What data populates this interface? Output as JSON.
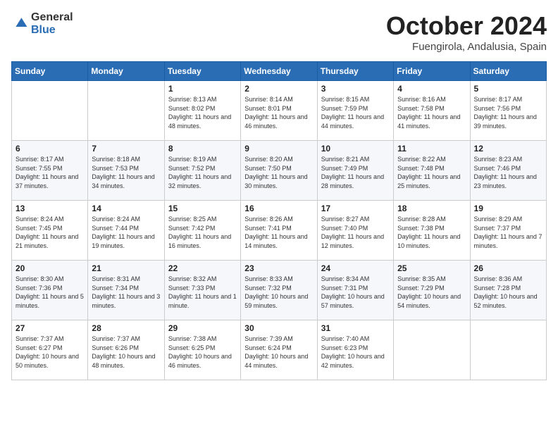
{
  "header": {
    "logo_general": "General",
    "logo_blue": "Blue",
    "month": "October 2024",
    "location": "Fuengirola, Andalusia, Spain"
  },
  "weekdays": [
    "Sunday",
    "Monday",
    "Tuesday",
    "Wednesday",
    "Thursday",
    "Friday",
    "Saturday"
  ],
  "weeks": [
    [
      {
        "day": "",
        "info": ""
      },
      {
        "day": "",
        "info": ""
      },
      {
        "day": "1",
        "info": "Sunrise: 8:13 AM\nSunset: 8:02 PM\nDaylight: 11 hours and 48 minutes."
      },
      {
        "day": "2",
        "info": "Sunrise: 8:14 AM\nSunset: 8:01 PM\nDaylight: 11 hours and 46 minutes."
      },
      {
        "day": "3",
        "info": "Sunrise: 8:15 AM\nSunset: 7:59 PM\nDaylight: 11 hours and 44 minutes."
      },
      {
        "day": "4",
        "info": "Sunrise: 8:16 AM\nSunset: 7:58 PM\nDaylight: 11 hours and 41 minutes."
      },
      {
        "day": "5",
        "info": "Sunrise: 8:17 AM\nSunset: 7:56 PM\nDaylight: 11 hours and 39 minutes."
      }
    ],
    [
      {
        "day": "6",
        "info": "Sunrise: 8:17 AM\nSunset: 7:55 PM\nDaylight: 11 hours and 37 minutes."
      },
      {
        "day": "7",
        "info": "Sunrise: 8:18 AM\nSunset: 7:53 PM\nDaylight: 11 hours and 34 minutes."
      },
      {
        "day": "8",
        "info": "Sunrise: 8:19 AM\nSunset: 7:52 PM\nDaylight: 11 hours and 32 minutes."
      },
      {
        "day": "9",
        "info": "Sunrise: 8:20 AM\nSunset: 7:50 PM\nDaylight: 11 hours and 30 minutes."
      },
      {
        "day": "10",
        "info": "Sunrise: 8:21 AM\nSunset: 7:49 PM\nDaylight: 11 hours and 28 minutes."
      },
      {
        "day": "11",
        "info": "Sunrise: 8:22 AM\nSunset: 7:48 PM\nDaylight: 11 hours and 25 minutes."
      },
      {
        "day": "12",
        "info": "Sunrise: 8:23 AM\nSunset: 7:46 PM\nDaylight: 11 hours and 23 minutes."
      }
    ],
    [
      {
        "day": "13",
        "info": "Sunrise: 8:24 AM\nSunset: 7:45 PM\nDaylight: 11 hours and 21 minutes."
      },
      {
        "day": "14",
        "info": "Sunrise: 8:24 AM\nSunset: 7:44 PM\nDaylight: 11 hours and 19 minutes."
      },
      {
        "day": "15",
        "info": "Sunrise: 8:25 AM\nSunset: 7:42 PM\nDaylight: 11 hours and 16 minutes."
      },
      {
        "day": "16",
        "info": "Sunrise: 8:26 AM\nSunset: 7:41 PM\nDaylight: 11 hours and 14 minutes."
      },
      {
        "day": "17",
        "info": "Sunrise: 8:27 AM\nSunset: 7:40 PM\nDaylight: 11 hours and 12 minutes."
      },
      {
        "day": "18",
        "info": "Sunrise: 8:28 AM\nSunset: 7:38 PM\nDaylight: 11 hours and 10 minutes."
      },
      {
        "day": "19",
        "info": "Sunrise: 8:29 AM\nSunset: 7:37 PM\nDaylight: 11 hours and 7 minutes."
      }
    ],
    [
      {
        "day": "20",
        "info": "Sunrise: 8:30 AM\nSunset: 7:36 PM\nDaylight: 11 hours and 5 minutes."
      },
      {
        "day": "21",
        "info": "Sunrise: 8:31 AM\nSunset: 7:34 PM\nDaylight: 11 hours and 3 minutes."
      },
      {
        "day": "22",
        "info": "Sunrise: 8:32 AM\nSunset: 7:33 PM\nDaylight: 11 hours and 1 minute."
      },
      {
        "day": "23",
        "info": "Sunrise: 8:33 AM\nSunset: 7:32 PM\nDaylight: 10 hours and 59 minutes."
      },
      {
        "day": "24",
        "info": "Sunrise: 8:34 AM\nSunset: 7:31 PM\nDaylight: 10 hours and 57 minutes."
      },
      {
        "day": "25",
        "info": "Sunrise: 8:35 AM\nSunset: 7:29 PM\nDaylight: 10 hours and 54 minutes."
      },
      {
        "day": "26",
        "info": "Sunrise: 8:36 AM\nSunset: 7:28 PM\nDaylight: 10 hours and 52 minutes."
      }
    ],
    [
      {
        "day": "27",
        "info": "Sunrise: 7:37 AM\nSunset: 6:27 PM\nDaylight: 10 hours and 50 minutes."
      },
      {
        "day": "28",
        "info": "Sunrise: 7:37 AM\nSunset: 6:26 PM\nDaylight: 10 hours and 48 minutes."
      },
      {
        "day": "29",
        "info": "Sunrise: 7:38 AM\nSunset: 6:25 PM\nDaylight: 10 hours and 46 minutes."
      },
      {
        "day": "30",
        "info": "Sunrise: 7:39 AM\nSunset: 6:24 PM\nDaylight: 10 hours and 44 minutes."
      },
      {
        "day": "31",
        "info": "Sunrise: 7:40 AM\nSunset: 6:23 PM\nDaylight: 10 hours and 42 minutes."
      },
      {
        "day": "",
        "info": ""
      },
      {
        "day": "",
        "info": ""
      }
    ]
  ]
}
